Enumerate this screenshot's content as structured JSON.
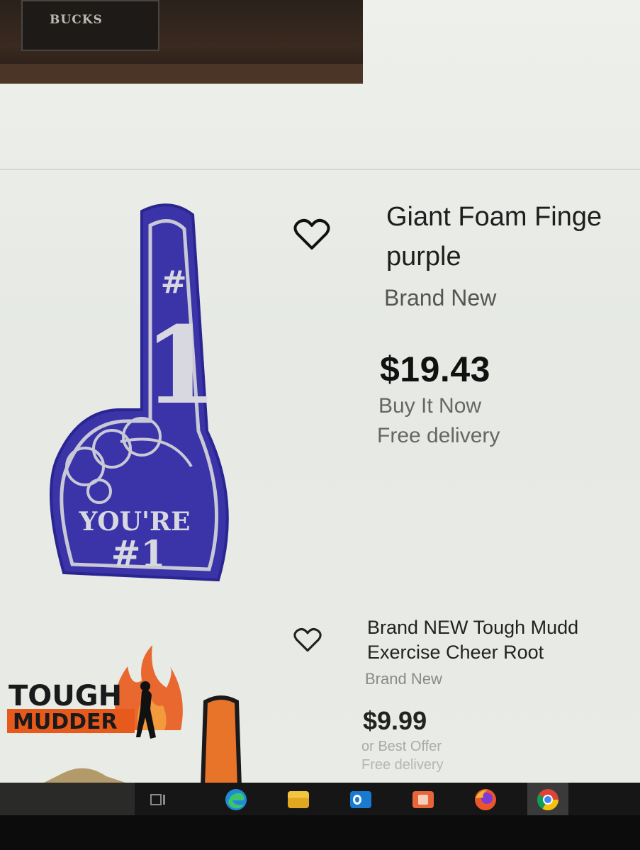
{
  "previous_listing": {
    "image_text": "BUCKS"
  },
  "listings": [
    {
      "title": "Giant Foam Finge",
      "title_line2": "purple",
      "condition": "Brand New",
      "price": "$19.43",
      "buying_format": "Buy It Now",
      "delivery": "Free delivery",
      "image_text_top": "#",
      "image_text_number": "1",
      "image_text_bottom1": "YOU'RE",
      "image_text_bottom2": "#1",
      "image_color": "#3a34a8"
    },
    {
      "title": "Brand NEW Tough Mudd",
      "title_line2": "Exercise Cheer Root",
      "condition": "Brand New",
      "price": "$9.99",
      "offer": "or Best Offer",
      "delivery": "Free delivery",
      "image_logo_line1": "TOUGH",
      "image_logo_line2": "MUDDER",
      "image_color": "#e85a1c"
    }
  ],
  "taskbar": {
    "items": [
      "task-view-icon",
      "edge-icon",
      "file-explorer-icon",
      "outlook-icon",
      "photos-icon",
      "firefox-icon",
      "chrome-icon"
    ]
  }
}
